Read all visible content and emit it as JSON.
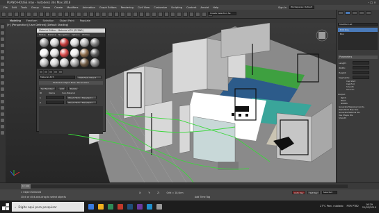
{
  "window": {
    "title": "PLANO-HOUSE.max - Autodesk 3ds Max 2018"
  },
  "menu": [
    "File",
    "Edit",
    "Tools",
    "Group",
    "Views",
    "Create",
    "Modifiers",
    "Animation",
    "Graph Editors",
    "Rendering",
    "Civil View",
    "Customize",
    "Scripting",
    "Content",
    "Arnold",
    "Help"
  ],
  "toolbar": {
    "signin": "Sign In",
    "workspace": "Workspaces: Default",
    "set_label": "Create Selection Se"
  },
  "ribbon": {
    "tab_modeling": "Modeling",
    "tab_freeform": "Freeform",
    "tab_selection": "Selection",
    "tab_objectpaint": "Object Paint",
    "tab_populate": "Populate",
    "sub_polygon": "Polygon Modeling"
  },
  "viewport": {
    "label": "[+] [Perspective] [User Defined] [Default Shading]"
  },
  "material_editor": {
    "title": "Material Editor - Material #25 (RCRNR)",
    "menu": [
      "Modes",
      "Material",
      "Navigation",
      "Options",
      "Utilities"
    ],
    "slot_name": "Material #25",
    "type_button": "Multi/Sub-Object",
    "rollout": "Multi/Sub-Object Basic Parameters",
    "set_number": "Set Number",
    "add": "Add",
    "delete": "Delete",
    "col_id": "ID",
    "col_name": "Name",
    "col_submat": "Sub-Material",
    "rows": [
      {
        "id": "1",
        "submat": "Wood (Std) ( Standard )"
      },
      {
        "id": "2",
        "submat": "Wood (Std) ( Standard )"
      }
    ]
  },
  "command_panel": {
    "modifier_list": "Modifier List",
    "stack_items": [
      "Edit Poly",
      "Box"
    ],
    "rollout": "Parameters",
    "length_label": "Length:",
    "width_label": "Width:",
    "height_label": "Height:",
    "segs_label": "Segments:",
    "options": [
      "Cap Start",
      "Cap End",
      "Smooth",
      "Slice On"
    ],
    "output_label": "Output",
    "output_opts": [
      "Patch",
      "Mesh",
      "NURBS"
    ],
    "gen_coords": "Generate Mapping Coords.",
    "real_world": "Real-World Map Size",
    "gen_matids": "Generate Material IDs",
    "use_shape": "Use Shape IDs",
    "smooth": "Smooth"
  },
  "timeline": {
    "frame": "0 / 100"
  },
  "status": {
    "selection": "1 Object Selected",
    "prompt": "Click or click-and-drag to select objects",
    "x": "X:",
    "y": "Y:",
    "z": "Z:",
    "grid": "Grid = 10,0cm",
    "addtime": "Add Time Tag",
    "autokey": "Auto Key",
    "setkey": "Set Key",
    "selected": "Selected"
  },
  "taskbar": {
    "search_placeholder": "Digite aqui para pesquisar",
    "tray_text": "POR PTB2",
    "time": "16:29",
    "date": "21/02/2019",
    "weather": "27°C Parc. nublado"
  },
  "colors": {
    "accent": "#4a7ab8",
    "selection_green": "#3bd83b",
    "floor_blue": "#2c5b8a",
    "floor_teal": "#3aa59a",
    "floor_green": "#3ea040"
  }
}
